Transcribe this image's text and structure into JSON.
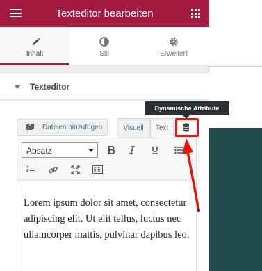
{
  "header": {
    "title": "Texteditor bearbeiten"
  },
  "tabs": [
    {
      "label": "Inhalt",
      "icon": "pencil-icon"
    },
    {
      "label": "Stil",
      "icon": "half-circle-icon"
    },
    {
      "label": "Erweitert",
      "icon": "gear-icon"
    }
  ],
  "section": {
    "title": "Texteditor"
  },
  "editor": {
    "media_label": "Dateien hinzufügen",
    "mode_visual": "Visuell",
    "mode_text": "Text",
    "format_value": "Absatz",
    "content": "Lorem ipsum dolor sit amet, consectetur adipiscing elit. Ut elit tellus, luctus nec ullamcorper mattis, pulvinar dapibus leo."
  },
  "tooltip": {
    "text": "Dynamische Attribute"
  },
  "colors": {
    "brand": "#a4193f",
    "highlight": "#e8170b",
    "preview_block": "#244b4d"
  }
}
